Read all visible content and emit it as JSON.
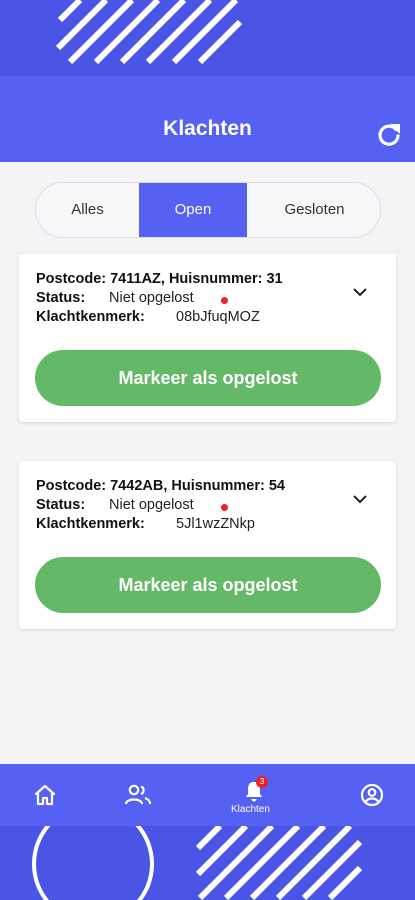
{
  "header": {
    "title": "Klachten",
    "refresh_icon": "refresh-icon"
  },
  "tabs": [
    {
      "label": "Alles",
      "active": false
    },
    {
      "label": "Open",
      "active": true
    },
    {
      "label": "Gesloten",
      "active": false
    }
  ],
  "complaints": [
    {
      "address_line": "Postcode: 7411AZ, Huisnummer: 31",
      "status_label": "Status:",
      "status_value": "Niet opgelost",
      "ref_label": "Klachtkenmerk:",
      "ref_value": "08bJfuqMOZ",
      "button_label": "Markeer als opgelost"
    },
    {
      "address_line": "Postcode: 7442AB, Huisnummer: 54",
      "status_label": "Status:",
      "status_value": "Niet opgelost",
      "ref_label": "Klachtkenmerk:",
      "ref_value": "5Jl1wzZNkp",
      "button_label": "Markeer als opgelost"
    }
  ],
  "bottom_nav": {
    "items": [
      {
        "icon": "home-icon",
        "label": ""
      },
      {
        "icon": "users-icon",
        "label": ""
      },
      {
        "icon": "bell-icon",
        "label": "Klachten",
        "badge": "3"
      },
      {
        "icon": "profile-icon",
        "label": ""
      }
    ]
  },
  "colors": {
    "primary": "#5561f2",
    "status_dot": "#e8232a",
    "resolve_button": "#63b968"
  }
}
